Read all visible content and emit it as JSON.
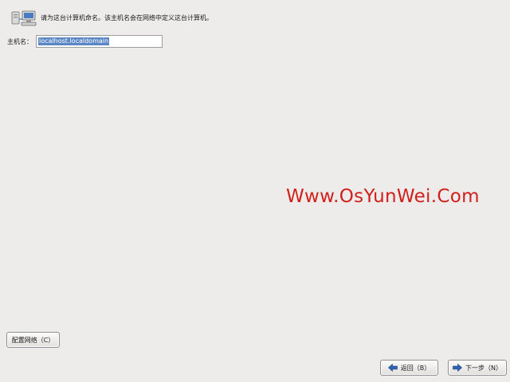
{
  "header": {
    "icon": "network-computers-icon",
    "instruction": "请为这台计算机命名。该主机名会在网络中定义这台计算机。"
  },
  "hostname": {
    "label": "主机名：",
    "value": "localhost.localdomain"
  },
  "watermark": "Www.OsYunWei.Com",
  "buttons": {
    "configure_network": "配置网络（C）",
    "back": "返回（B）",
    "next": "下一步（N）"
  },
  "colors": {
    "background": "#edeceb",
    "watermark": "#d1201c",
    "selection": "#5b86c5",
    "arrow_icon": "#2f62b0"
  }
}
